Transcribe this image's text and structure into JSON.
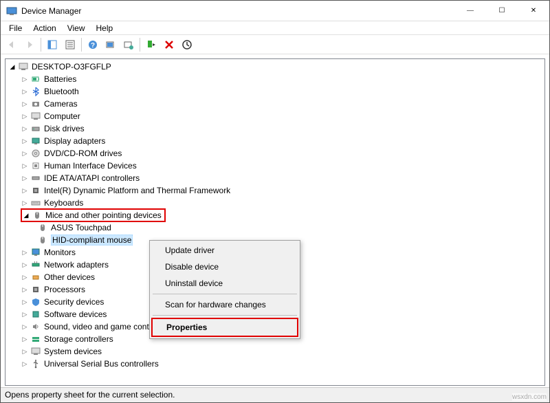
{
  "window": {
    "title": "Device Manager"
  },
  "menu": {
    "file": "File",
    "action": "Action",
    "view": "View",
    "help": "Help"
  },
  "tree": {
    "root": "DESKTOP-O3FGFLP",
    "nodes": [
      "Batteries",
      "Bluetooth",
      "Cameras",
      "Computer",
      "Disk drives",
      "Display adapters",
      "DVD/CD-ROM drives",
      "Human Interface Devices",
      "IDE ATA/ATAPI controllers",
      "Intel(R) Dynamic Platform and Thermal Framework",
      "Keyboards"
    ],
    "mice_category": "Mice and other pointing devices",
    "mice_children": {
      "touchpad": "ASUS Touchpad",
      "hid_mouse": "HID-compliant mouse"
    },
    "nodes_after": [
      "Monitors",
      "Network adapters",
      "Other devices",
      "Processors",
      "Security devices",
      "Software devices",
      "Sound, video and game controllers",
      "Storage controllers",
      "System devices",
      "Universal Serial Bus controllers"
    ]
  },
  "context_menu": {
    "update": "Update driver",
    "disable": "Disable device",
    "uninstall": "Uninstall device",
    "scan": "Scan for hardware changes",
    "properties": "Properties"
  },
  "statusbar": {
    "text": "Opens property sheet for the current selection."
  },
  "watermark": "wsxdn.com",
  "icons": {
    "computer": "computer-icon",
    "battery": "battery-icon",
    "bluetooth": "bluetooth-icon",
    "camera": "camera-icon",
    "disk": "disk-icon",
    "display": "display-icon",
    "dvd": "dvd-icon",
    "hid": "hid-icon",
    "ide": "ide-icon",
    "intel": "chip-icon",
    "keyboard": "keyboard-icon",
    "mouse": "mouse-icon",
    "monitor": "monitor-icon",
    "network": "network-icon",
    "other": "other-icon",
    "processor": "processor-icon",
    "security": "security-icon",
    "software": "software-icon",
    "sound": "sound-icon",
    "storage": "storage-icon",
    "system": "system-icon",
    "usb": "usb-icon"
  }
}
